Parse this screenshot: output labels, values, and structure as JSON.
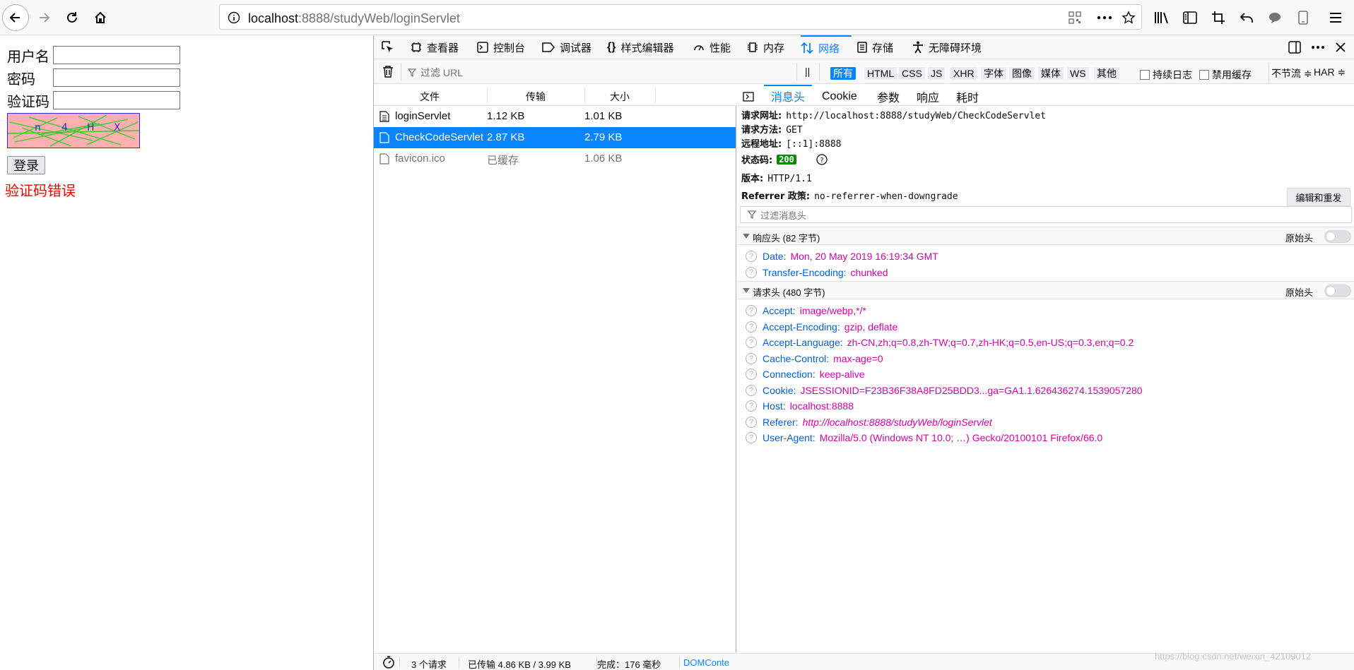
{
  "browser": {
    "url_host": "localhost",
    "url_rest": ":8888/studyWeb/loginServlet"
  },
  "page": {
    "username_label": "用户名",
    "password_label": "密码",
    "captcha_label": "验证码",
    "captcha_chars": [
      "n",
      "4",
      "H",
      "X"
    ],
    "login_button": "登录",
    "error_message": "验证码错误"
  },
  "devtools": {
    "tabs": [
      {
        "label": "查看器",
        "icon": "inspector-icon"
      },
      {
        "label": "控制台",
        "icon": "console-icon"
      },
      {
        "label": "调试器",
        "icon": "debugger-icon"
      },
      {
        "label": "样式编辑器",
        "icon": "style-editor-icon"
      },
      {
        "label": "性能",
        "icon": "performance-icon"
      },
      {
        "label": "内存",
        "icon": "memory-icon"
      },
      {
        "label": "网络",
        "icon": "network-icon"
      },
      {
        "label": "存储",
        "icon": "storage-icon"
      },
      {
        "label": "无障碍环境",
        "icon": "accessibility-icon"
      }
    ],
    "filter_placeholder": "过滤 URL",
    "filter_types": [
      "所有",
      "HTML",
      "CSS",
      "JS",
      "XHR",
      "字体",
      "图像",
      "媒体",
      "WS",
      "其他"
    ],
    "persist_logs": "持续日志",
    "disable_cache": "禁用缓存",
    "throttle": "不节流 ≑",
    "har": "HAR ≑",
    "columns": [
      "文件",
      "传输",
      "大小"
    ],
    "requests": [
      {
        "file": "loginServlet",
        "transferred": "1.12 KB",
        "size": "1.01 KB"
      },
      {
        "file": "CheckCodeServlet",
        "transferred": "2.87 KB",
        "size": "2.79 KB"
      },
      {
        "file": "favicon.ico",
        "transferred": "已缓存",
        "size": "1.06 KB"
      }
    ],
    "detail_tabs": [
      "消息头",
      "Cookie",
      "参数",
      "响应",
      "耗时"
    ],
    "summary": {
      "url_label": "请求网址:",
      "url_value": "http://localhost:8888/studyWeb/CheckCodeServlet",
      "method_label": "请求方法:",
      "method_value": "GET",
      "remote_label": "远程地址:",
      "remote_value": "[::1]:8888",
      "status_label": "状态码:",
      "status_value": "200",
      "version_label": "版本:",
      "version_value": "HTTP/1.1",
      "referrer_label": "Referrer 政策:",
      "referrer_value": "no-referrer-when-downgrade"
    },
    "edit_resend": "编辑和重发",
    "headers_filter_placeholder": "过滤消息头",
    "response_headers_title": "响应头 (82 字节)",
    "request_headers_title": "请求头 (480 字节)",
    "raw_headers": "原始头",
    "response_headers": [
      {
        "k": "Date:",
        "v": "Mon, 20 May 2019 16:19:34 GMT"
      },
      {
        "k": "Transfer-Encoding:",
        "v": "chunked"
      }
    ],
    "request_headers": [
      {
        "k": "Accept:",
        "v": "image/webp,*/*"
      },
      {
        "k": "Accept-Encoding:",
        "v": "gzip, deflate"
      },
      {
        "k": "Accept-Language:",
        "v": "zh-CN,zh;q=0.8,zh-TW;q=0.7,zh-HK;q=0.5,en-US;q=0.3,en;q=0.2"
      },
      {
        "k": "Cache-Control:",
        "v": "max-age=0"
      },
      {
        "k": "Connection:",
        "v": "keep-alive"
      },
      {
        "k": "Cookie:",
        "v": "JSESSIONID=F23B36F38A8FD25BDD3...ga=GA1.1.626436274.1539057280"
      },
      {
        "k": "Host:",
        "v": "localhost:8888"
      },
      {
        "k": "Referer:",
        "v": "http://localhost:8888/studyWeb/loginServlet"
      },
      {
        "k": "User-Agent:",
        "v": "Mozilla/5.0 (Windows NT 10.0; …) Gecko/20100101 Firefox/66.0"
      }
    ],
    "footer": {
      "requests": "3 个请求",
      "transferred": "已传输 4.86 KB / 3.99 KB",
      "finish": "完成：176 毫秒",
      "domcontent": "DOMConte"
    }
  },
  "watermark": "https://blog.csdn.net/weixin_42109012",
  "colors": {
    "accent": "#0a84ff",
    "error": "#ff0000",
    "status_ok": "#058b00",
    "header_key": "#0060df",
    "header_value": "#dd00a9"
  }
}
